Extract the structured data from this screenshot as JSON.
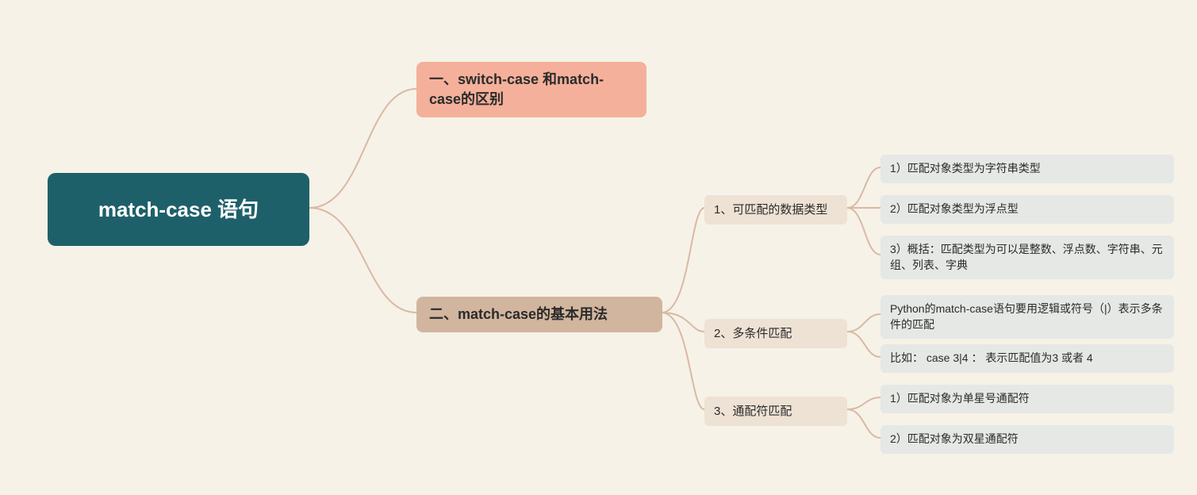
{
  "root": {
    "title": "match-case 语句"
  },
  "l1": {
    "a": "一、switch-case 和match-case的区别",
    "b": "二、match-case的基本用法"
  },
  "l2": {
    "s1": "1、可匹配的数据类型",
    "s2": "2、多条件匹配",
    "s3": "3、通配符匹配"
  },
  "l3": {
    "s1_1": "1）匹配对象类型为字符串类型",
    "s1_2": "2）匹配对象类型为浮点型",
    "s1_3": "3）概括：匹配类型为可以是整数、浮点数、字符串、元组、列表、字典",
    "s2_1": "Python的match-case语句要用逻辑或符号（|）表示多条件的匹配",
    "s2_2": "比如：  case 3|4 ： 表示匹配值为3 或者 4",
    "s3_1": "1）匹配对象为单星号通配符",
    "s3_2": "2）匹配对象为双星通配符"
  }
}
